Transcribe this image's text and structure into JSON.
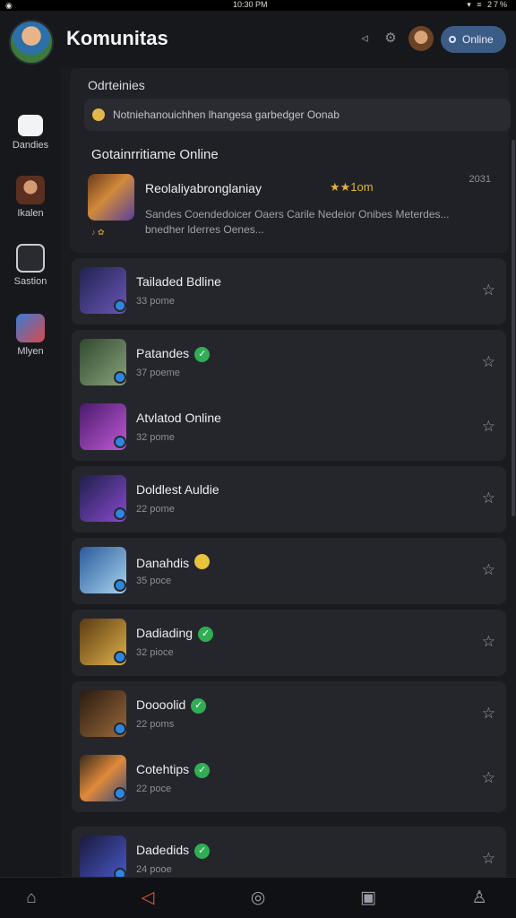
{
  "status": {
    "time": "10:30 PM",
    "battery": "27%"
  },
  "header": {
    "title": "Komunitas",
    "online_button": "Online"
  },
  "sidebar": {
    "items": [
      {
        "label": "Dandies",
        "icon": "chat-icon"
      },
      {
        "label": "Ikalen",
        "icon": "hero-avatar-icon"
      },
      {
        "label": "Sastion",
        "icon": "bag-icon"
      },
      {
        "label": "Mlyen",
        "icon": "heart-app-icon"
      }
    ]
  },
  "main": {
    "section_label": "Odrteinies",
    "notice": "Notniehanouichhen lhangesa garbedger Oonab",
    "online_heading": "Gotainrritiame Online",
    "featured": {
      "title": "Reolaliyabronglaniay",
      "extra": "★★1om",
      "time": "2031",
      "description": "Sandes Coendedoicer Oaers Carile Nedeior Onibes Meterdes... bnedher lderres Oenes...",
      "tags": "♪ ✿"
    },
    "groups": [
      {
        "rows": [
          {
            "title": "Tailaded Bdline",
            "sub": "33 pome",
            "badge": "none",
            "thumb_color": "#5a4a9e"
          }
        ]
      },
      {
        "rows": [
          {
            "title": "Patandes",
            "sub": "37 poeme",
            "badge": "verified",
            "thumb_color": "#3f5d3f"
          },
          {
            "title": "Atvlatod Online",
            "sub": "32 pome",
            "badge": "none",
            "thumb_color": "#9a3ab8"
          }
        ]
      },
      {
        "rows": [
          {
            "title": "Doldlest Auldie",
            "sub": "22 pome",
            "badge": "none",
            "thumb_color": "#4b3a8c"
          }
        ]
      },
      {
        "rows": [
          {
            "title": "Danahdis",
            "sub": "35 poce",
            "badge": "emoji",
            "thumb_color": "#3b86c9"
          }
        ]
      },
      {
        "rows": [
          {
            "title": "Dadiading",
            "sub": "32 pioce",
            "badge": "verified",
            "thumb_color": "#c48a2a"
          }
        ]
      },
      {
        "rows": [
          {
            "title": "Doooolid",
            "sub": "22 poms",
            "badge": "verified",
            "thumb_color": "#7a4e2a"
          },
          {
            "title": "Cotehtips",
            "sub": "22 poce",
            "badge": "verified",
            "thumb_color": "#c66a2b"
          }
        ]
      },
      {
        "rows": [
          {
            "title": "Dadedids",
            "sub": "24 pooe",
            "badge": "verified",
            "thumb_color": "#3c4a9a"
          }
        ]
      }
    ]
  },
  "bottom_nav": [
    "home-icon",
    "share-icon",
    "compass-icon",
    "image-icon",
    "profile-icon"
  ],
  "colors": {
    "accent": "#e55b35",
    "online_button": "#3c5c86",
    "verified": "#2fae54"
  }
}
